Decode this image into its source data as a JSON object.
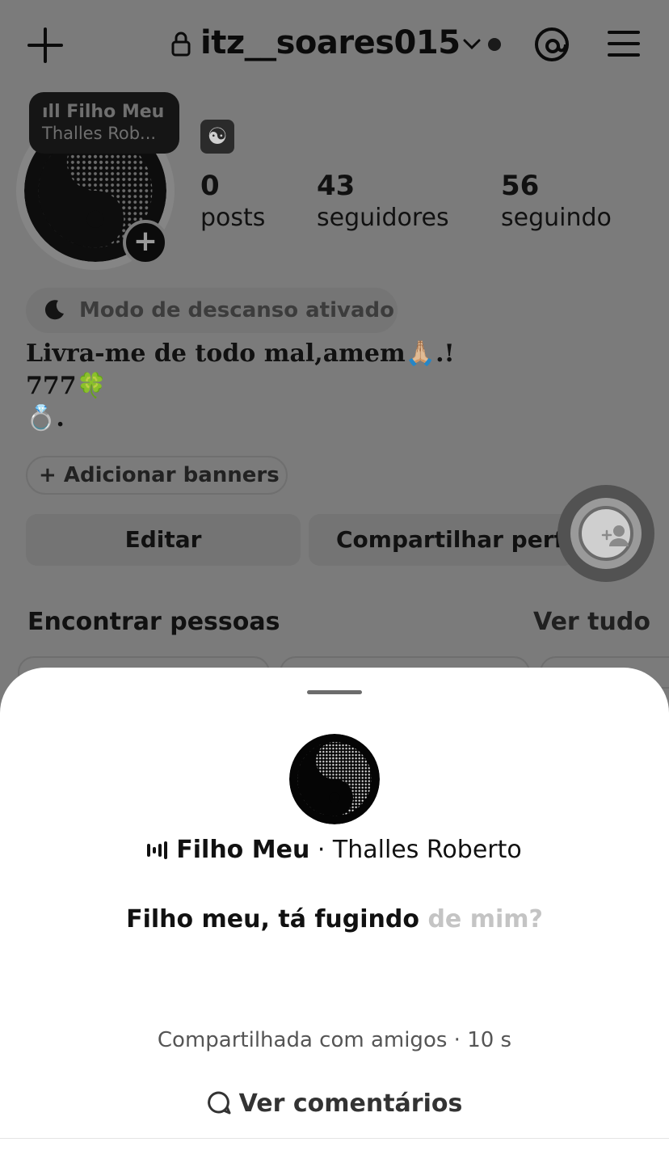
{
  "header": {
    "username": "itz__soares015",
    "icons": [
      "plus-icon",
      "lock-icon",
      "chevron-down-icon",
      "threads-icon",
      "menu-icon"
    ]
  },
  "note": {
    "song_title": "Filho Meu",
    "artist_short": "Thalles Rob..."
  },
  "stats": [
    {
      "number": "0",
      "label": "posts"
    },
    {
      "number": "43",
      "label": "seguidores"
    },
    {
      "number": "56",
      "label": "seguindo"
    }
  ],
  "rest_mode": "Modo de descanso ativado",
  "bio": {
    "line1": "Livra-me de todo mal,amem🙏🏼.!",
    "line2": "777🍀",
    "line3": "💍."
  },
  "add_banners": "+ Adicionar banners",
  "buttons": {
    "edit": "Editar",
    "share": "Compartilhar perfil"
  },
  "find_people": {
    "title": "Encontrar pessoas",
    "see_all": "Ver tudo"
  },
  "sheet": {
    "song": "Filho Meu",
    "separator": " · ",
    "artist": "Thalles Roberto",
    "lyric_active": "Filho meu, tá fugindo",
    "lyric_dim": " de mim?",
    "shared": "Compartilhada com amigos · 10 s",
    "comments": "Ver comentários"
  },
  "colors": {
    "overlay_bg": "#7b7b7b",
    "sheet_bg": "#ffffff",
    "dim_lyric": "#c4c4c4"
  }
}
